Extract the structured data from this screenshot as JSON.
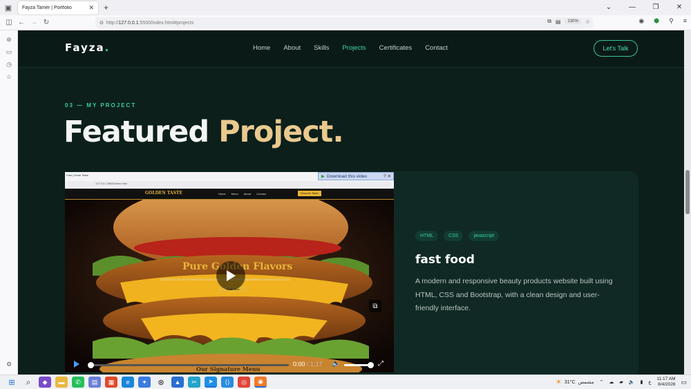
{
  "browser": {
    "tab_title": "Fayza Tamer | Portfolio",
    "url_grey": "http://",
    "url_host": "127.0.0.1",
    "url_rest": ":5500/index.html#projects",
    "zoom": "130%"
  },
  "site": {
    "logo": "Fayza",
    "logo_dot": ".",
    "nav": [
      "Home",
      "About",
      "Skills",
      "Projects",
      "Certificates",
      "Contact"
    ],
    "active_nav": "Projects",
    "cta": "Let's Talk",
    "accent": "#3ad1a0"
  },
  "section": {
    "eyebrow": "03 — MY PROJECT",
    "heading_main": "Featured ",
    "heading_accent": "Project."
  },
  "project": {
    "tags": [
      "HTML",
      "CSS",
      "javascript"
    ],
    "title": "fast food",
    "description": "A modern and responsive beauty products website built using HTML, CSS and Bootstrap, with a clean design and user-friendly interface."
  },
  "video": {
    "download_label": "Download this video",
    "inner_tab": "Fast | Order Taste",
    "inner_url": "127.0.0.1:5500/index.html",
    "brand": "GOLDEN TASTE",
    "inner_nav": [
      "Home",
      "Menu",
      "About",
      "Contact"
    ],
    "reserve": "Reserve Table",
    "hero_title": "Pure Golden Flavors",
    "hero_sub": "Experience the art of fast food in every bite, made with fresh ingredients to choose just for you.",
    "order_btn": "Order Now",
    "next_section": "Our Signature Menu",
    "current_time": "0:00",
    "separator": " / ",
    "duration": "1:17"
  },
  "taskbar": {
    "temperature": "31°C",
    "weather_label": "مشمس",
    "time": "11:17 AM",
    "date": "8/4/2026",
    "lang": "ع"
  }
}
